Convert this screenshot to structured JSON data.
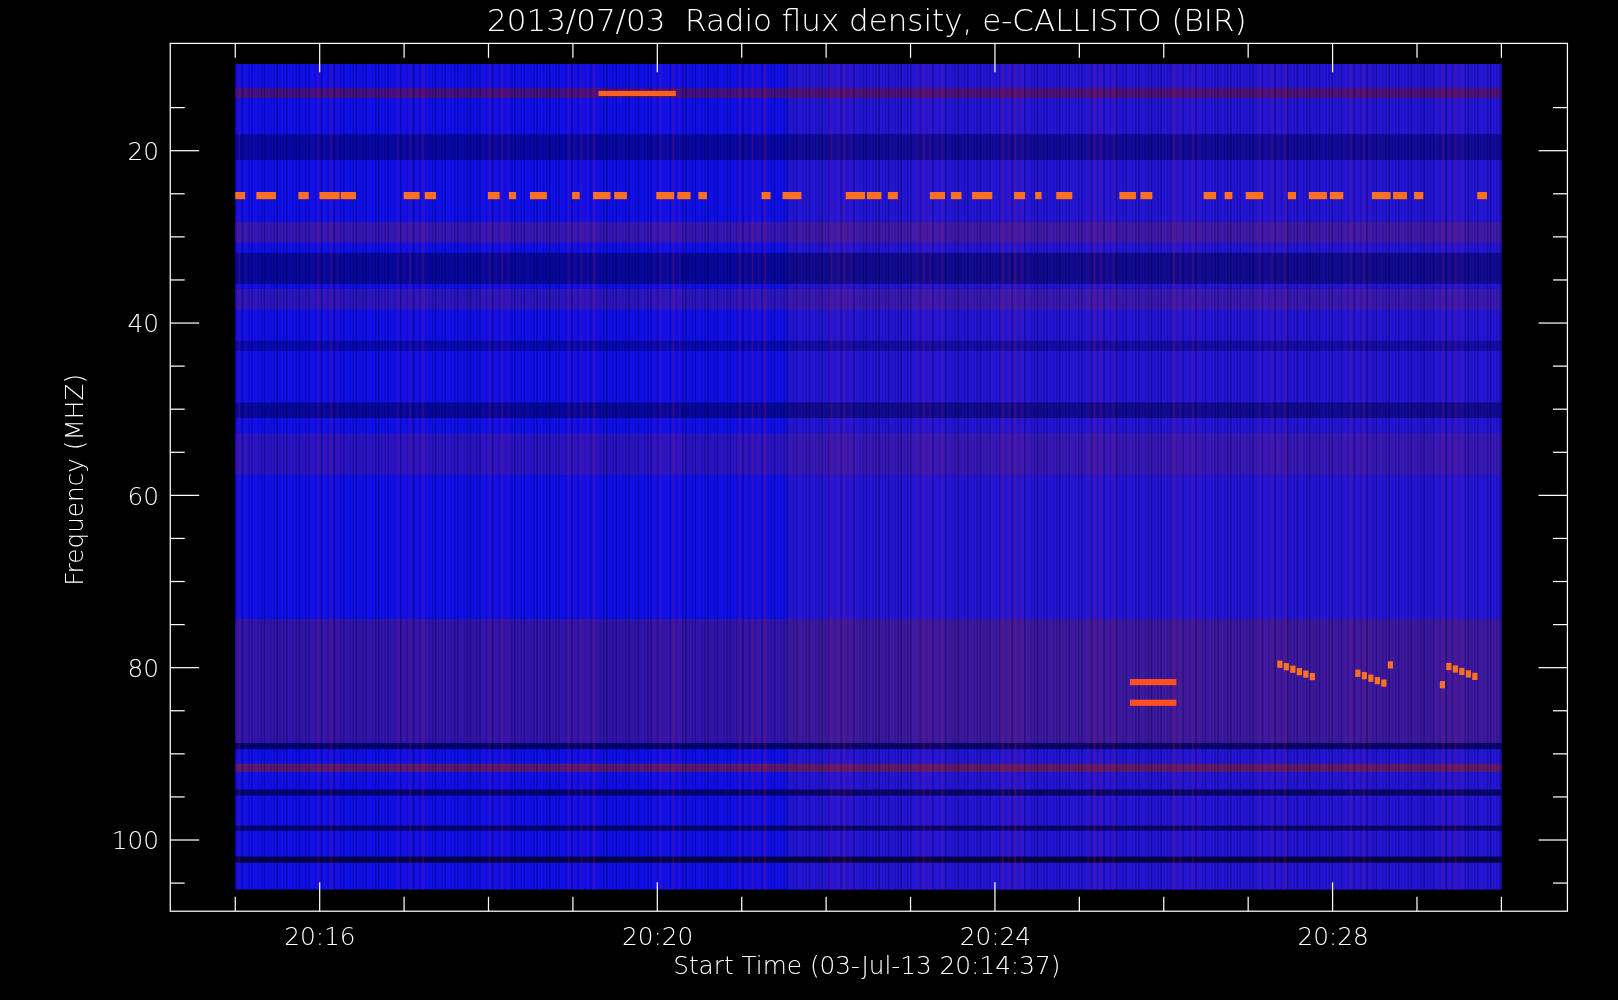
{
  "plot": {
    "title": "2013/07/03  Radio flux density, e-CALLISTO (BIR)",
    "ylabel": "Frequency (MHZ)",
    "xlabel": "Start Time (03-Jul-13 20:14:37)",
    "yticks": [
      "20",
      "40",
      "60",
      "80",
      "100"
    ],
    "xticks": [
      "20:16",
      "20:20",
      "20:24",
      "20:28"
    ]
  }
}
